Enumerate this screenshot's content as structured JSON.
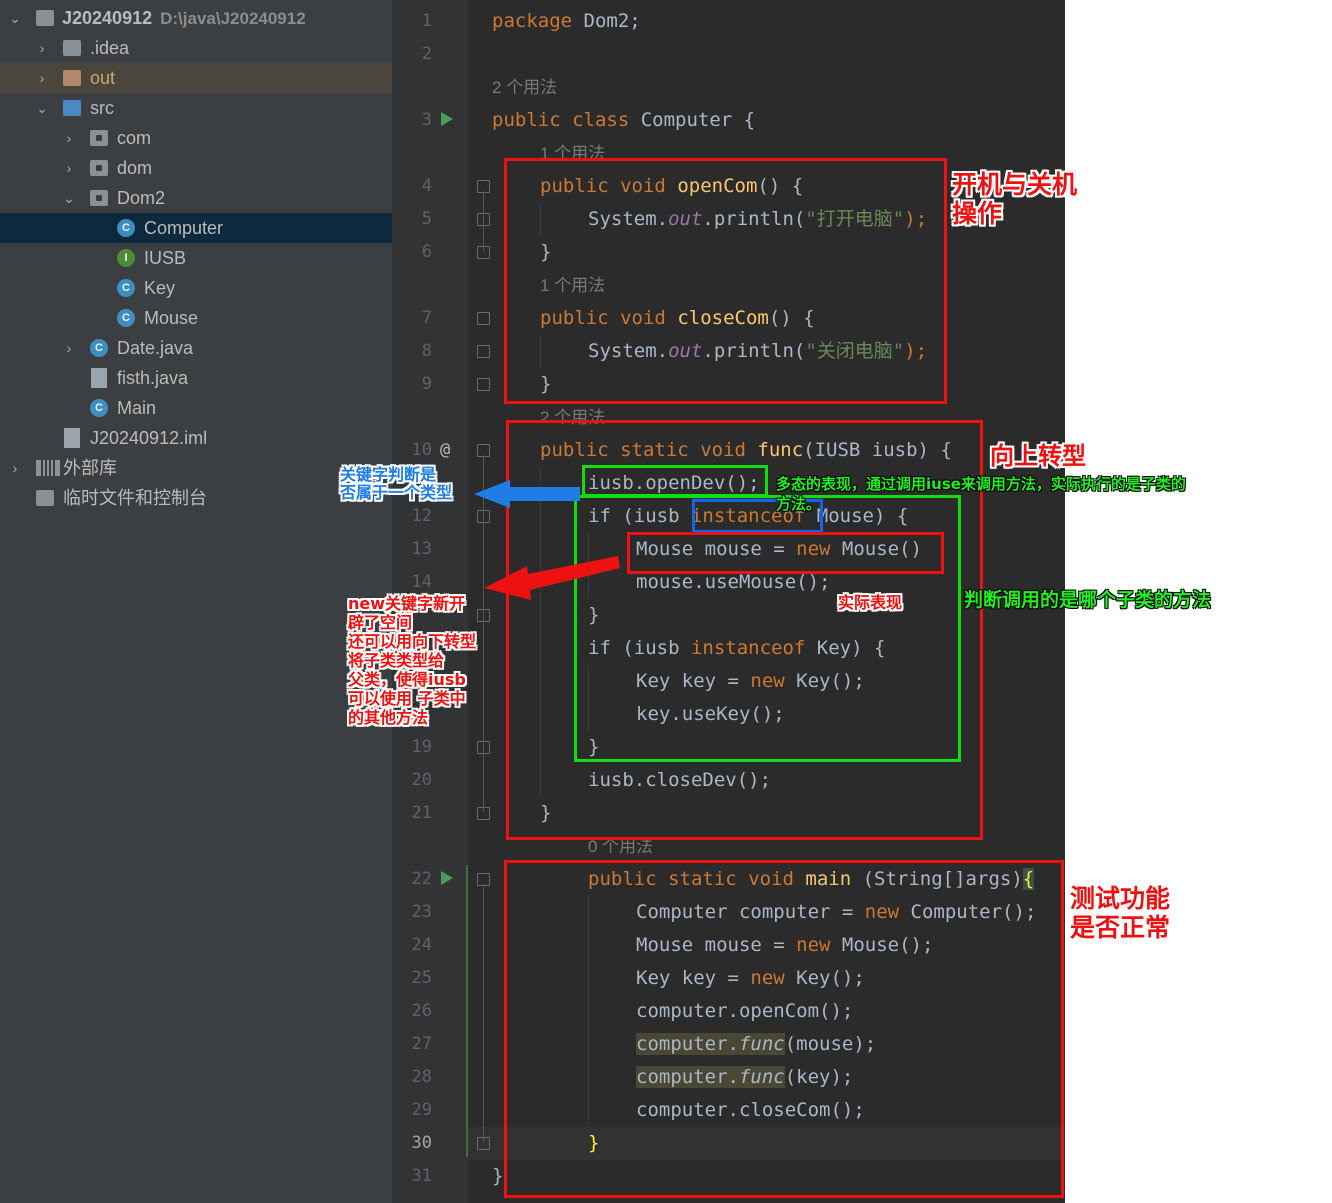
{
  "project_tree": {
    "root": {
      "label": "J20240912",
      "path": "D:\\java\\J20240912"
    },
    "items": [
      {
        "label": ".idea",
        "kind": "folder"
      },
      {
        "label": "out",
        "kind": "folder-excluded"
      },
      {
        "label": "src",
        "kind": "folder-source"
      },
      {
        "label": "com",
        "kind": "package"
      },
      {
        "label": "dom",
        "kind": "package"
      },
      {
        "label": "Dom2",
        "kind": "package"
      },
      {
        "label": "Computer",
        "kind": "class",
        "icon_letter": "C",
        "selected": true
      },
      {
        "label": "IUSB",
        "kind": "interface",
        "icon_letter": "I"
      },
      {
        "label": "Key",
        "kind": "class",
        "icon_letter": "C"
      },
      {
        "label": "Mouse",
        "kind": "class",
        "icon_letter": "C"
      },
      {
        "label": "Date.java",
        "kind": "class-file",
        "icon_letter": "C"
      },
      {
        "label": "fisth.java",
        "kind": "java-file"
      },
      {
        "label": "Main",
        "kind": "class",
        "icon_letter": "C"
      },
      {
        "label": "J20240912.iml",
        "kind": "iml-file"
      },
      {
        "label": "外部库",
        "kind": "libraries"
      },
      {
        "label": "临时文件和控制台",
        "kind": "scratches"
      }
    ]
  },
  "editor": {
    "line_numbers": [
      "1",
      "2",
      "3",
      "4",
      "5",
      "6",
      "7",
      "8",
      "9",
      "10",
      "12",
      "13",
      "14",
      "19",
      "20",
      "21",
      "22",
      "23",
      "24",
      "25",
      "26",
      "27",
      "28",
      "29",
      "30",
      "31"
    ],
    "current_line": "30",
    "usage_hints": [
      "2 个用法",
      "1 个用法",
      "1 个用法",
      "2 个用法",
      "0 个用法"
    ],
    "code_lines": {
      "l1": {
        "kw": "package",
        "rest": " Dom2;"
      },
      "l3": {
        "kw1": "public",
        "kw2": "class",
        "rest": " Computer {"
      },
      "l4": {
        "kw1": "public",
        "kw2": "void",
        "fn": "openCom",
        "rest": "() {"
      },
      "l5": {
        "a": "System.",
        "b": "out",
        "c": ".println(",
        "s": "\"打开电脑\"",
        "d": ");"
      },
      "l6": "}",
      "l7": {
        "kw1": "public",
        "kw2": "void",
        "fn": "closeCom",
        "rest": "() {"
      },
      "l8": {
        "a": "System.",
        "b": "out",
        "c": ".println(",
        "s": "\"关闭电脑\"",
        "d": ");"
      },
      "l9": "}",
      "l10": {
        "kw1": "public",
        "kw2": "static",
        "kw3": "void",
        "fn": "func",
        "rest": "(IUSB iusb) {"
      },
      "l11": "iusb.openDev();",
      "l12": {
        "a": "if (iusb ",
        "kw": "instanceof",
        "b": " Mouse) {"
      },
      "l13": {
        "a": "Mouse mouse = ",
        "kw": "new",
        "b": " Mouse()"
      },
      "l14": "mouse.useMouse();",
      "l15": "}",
      "l16": {
        "a": "if (iusb ",
        "kw": "instanceof",
        "b": " Key) {"
      },
      "l17": {
        "a": "Key key = ",
        "kw": "new",
        "b": " Key();"
      },
      "l18": "key.useKey();",
      "l19": "}",
      "l20": "iusb.closeDev();",
      "l21": "}",
      "l22": {
        "kw1": "public",
        "kw2": "static",
        "kw3": "void",
        "fn": "main",
        "rest": " (String[]args)",
        "brace": "{"
      },
      "l23": {
        "a": "Computer computer = ",
        "kw": "new",
        "b": " Computer();"
      },
      "l24": {
        "a": "Mouse mouse = ",
        "kw": "new",
        "b": " Mouse();"
      },
      "l25": {
        "a": "Key key = ",
        "kw": "new",
        "b": " Key();"
      },
      "l26": "computer.openCom();",
      "l27": {
        "a": "computer.",
        "f": "func",
        "b": "(mouse);"
      },
      "l28": {
        "a": "computer.",
        "f": "func",
        "b": "(key);"
      },
      "l29": "computer.closeCom();",
      "l30": "}",
      "l31": "}"
    },
    "gutter_marker": "@"
  },
  "annotations": {
    "on_off": "开机与关机\n操作",
    "upcast": "向上转型",
    "polymorphism": "多态的表现，通过调用iuse来调用方法，实际执行的是子类的\n方法。",
    "keyword_note": "关键字判断是\n否属于一个类型",
    "new_note": "new关键字新开\n辟了空间\n还可以用向下转型\n将子类类型给\n父类，使得iusb\n可以使用 子类中\n的其他方法",
    "actual": "实际表现",
    "which_subclass": "判断调用的是哪个子类的方法",
    "test": "测试功能\n是否正常"
  },
  "colors": {
    "red": "#ee1111",
    "green": "#11dd11",
    "blue": "#1166ee",
    "keyword": "#cc7832",
    "function": "#ffc66d",
    "string": "#6a8759",
    "static_field": "#9876aa"
  }
}
